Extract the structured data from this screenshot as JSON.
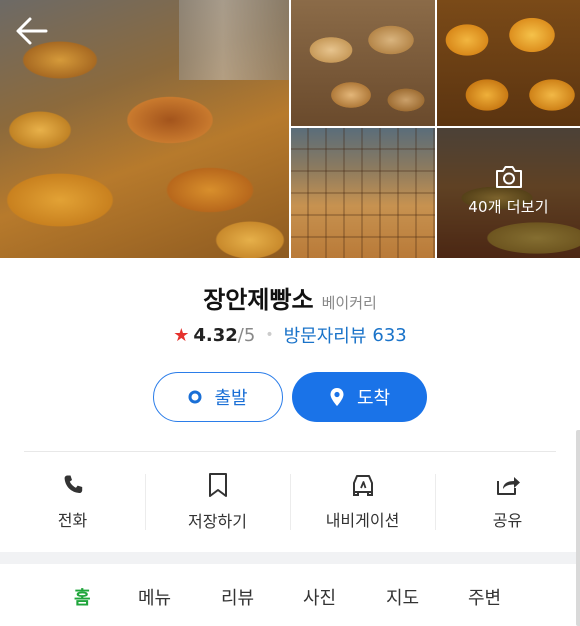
{
  "place": {
    "name": "장안제빵소",
    "category": "베이커리"
  },
  "gallery": {
    "more_label": "40개 더보기"
  },
  "rating": {
    "value": "4.32",
    "max": "/5",
    "review_link": "방문자리뷰",
    "review_count": "633"
  },
  "buttons": {
    "depart": "출발",
    "arrive": "도착"
  },
  "actions": {
    "call": "전화",
    "save": "저장하기",
    "navigate": "내비게이션",
    "share": "공유"
  },
  "tabs": [
    "홈",
    "메뉴",
    "리뷰",
    "사진",
    "지도",
    "주변"
  ],
  "colors": {
    "accent_blue": "#1a73e8",
    "review_blue": "#1a73c9",
    "active_tab_green": "#1fa53b",
    "star_red": "#e5322d"
  }
}
